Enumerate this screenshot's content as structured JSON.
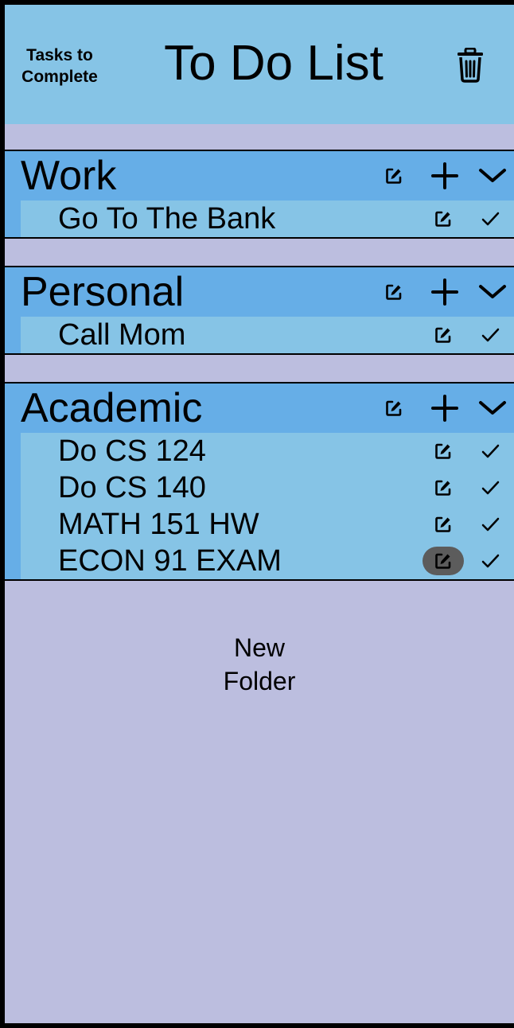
{
  "header": {
    "tasks_label": "Tasks to\nComplete",
    "title": "To Do List",
    "trash_icon": "trash-icon"
  },
  "folders": [
    {
      "name": "Work",
      "icons": [
        "edit-icon",
        "plus-icon",
        "chevron-down-icon"
      ],
      "tasks": [
        {
          "label": "Go To The Bank"
        }
      ]
    },
    {
      "name": "Personal",
      "icons": [
        "edit-icon",
        "plus-icon",
        "chevron-down-icon"
      ],
      "tasks": [
        {
          "label": "Call Mom"
        }
      ]
    },
    {
      "name": "Academic",
      "icons": [
        "edit-icon",
        "plus-icon",
        "chevron-down-icon"
      ],
      "tasks": [
        {
          "label": "Do CS 124"
        },
        {
          "label": "Do CS 140"
        },
        {
          "label": "MATH 151 HW"
        },
        {
          "label": "ECON 91 EXAM",
          "edit_active": true
        }
      ]
    }
  ],
  "new_folder_label": "New\nFolder",
  "colors": {
    "background": "#BCBEDF",
    "header": "#86C4E6",
    "folder_header": "#66AEE7",
    "task_row": "#86C4E6",
    "active_edit": "#5C5C5C"
  }
}
